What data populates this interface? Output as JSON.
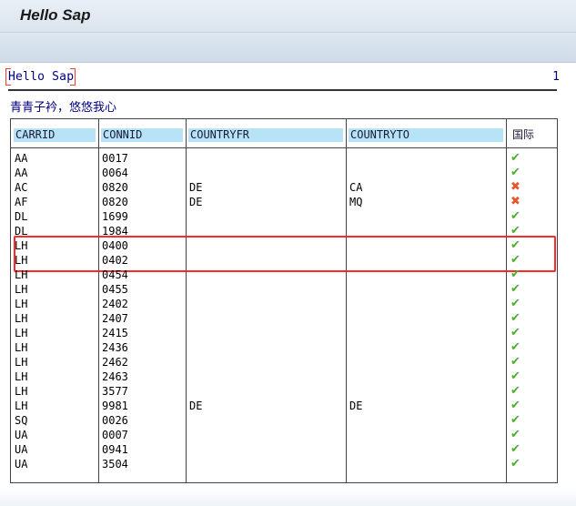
{
  "window": {
    "title": "Hello Sap"
  },
  "report": {
    "header_title": "Hello Sap",
    "page_number": "1",
    "subtitle": "青青子衿，悠悠我心"
  },
  "table": {
    "headers": [
      "CARRID",
      "CONNID",
      "COUNTRYFR",
      "COUNTRYTO",
      "国际"
    ],
    "rows": [
      {
        "carrid": "AA",
        "connid": "0017",
        "countryfr": "",
        "countryto": "",
        "intl": "check"
      },
      {
        "carrid": "AA",
        "connid": "0064",
        "countryfr": "",
        "countryto": "",
        "intl": "check"
      },
      {
        "carrid": "AC",
        "connid": "0820",
        "countryfr": "DE",
        "countryto": "CA",
        "intl": "cross"
      },
      {
        "carrid": "AF",
        "connid": "0820",
        "countryfr": "DE",
        "countryto": "MQ",
        "intl": "cross"
      },
      {
        "carrid": "DL",
        "connid": "1699",
        "countryfr": "",
        "countryto": "",
        "intl": "check"
      },
      {
        "carrid": "DL",
        "connid": "1984",
        "countryfr": "",
        "countryto": "",
        "intl": "check"
      },
      {
        "carrid": "LH",
        "connid": "0400",
        "countryfr": "",
        "countryto": "",
        "intl": "check"
      },
      {
        "carrid": "LH",
        "connid": "0402",
        "countryfr": "",
        "countryto": "",
        "intl": "check"
      },
      {
        "carrid": "LH",
        "connid": "0454",
        "countryfr": "",
        "countryto": "",
        "intl": "check"
      },
      {
        "carrid": "LH",
        "connid": "0455",
        "countryfr": "",
        "countryto": "",
        "intl": "check"
      },
      {
        "carrid": "LH",
        "connid": "2402",
        "countryfr": "",
        "countryto": "",
        "intl": "check"
      },
      {
        "carrid": "LH",
        "connid": "2407",
        "countryfr": "",
        "countryto": "",
        "intl": "check"
      },
      {
        "carrid": "LH",
        "connid": "2415",
        "countryfr": "",
        "countryto": "",
        "intl": "check"
      },
      {
        "carrid": "LH",
        "connid": "2436",
        "countryfr": "",
        "countryto": "",
        "intl": "check"
      },
      {
        "carrid": "LH",
        "connid": "2462",
        "countryfr": "",
        "countryto": "",
        "intl": "check"
      },
      {
        "carrid": "LH",
        "connid": "2463",
        "countryfr": "",
        "countryto": "",
        "intl": "check"
      },
      {
        "carrid": "LH",
        "connid": "3577",
        "countryfr": "",
        "countryto": "",
        "intl": "check"
      },
      {
        "carrid": "LH",
        "connid": "9981",
        "countryfr": "DE",
        "countryto": "DE",
        "intl": "check"
      },
      {
        "carrid": "SQ",
        "connid": "0026",
        "countryfr": "",
        "countryto": "",
        "intl": "check"
      },
      {
        "carrid": "UA",
        "connid": "0007",
        "countryfr": "",
        "countryto": "",
        "intl": "check"
      },
      {
        "carrid": "UA",
        "connid": "0941",
        "countryfr": "",
        "countryto": "",
        "intl": "check"
      },
      {
        "carrid": "UA",
        "connid": "3504",
        "countryfr": "",
        "countryto": "",
        "intl": "check"
      }
    ]
  },
  "icons": {
    "check": "checkmark-icon",
    "cross": "cross-icon"
  },
  "colors": {
    "check": "#4caf2a",
    "cross": "#e4572e",
    "highlight": "#ff2b2b",
    "header_cell": "#b6e3f5",
    "text": "#00007f"
  }
}
